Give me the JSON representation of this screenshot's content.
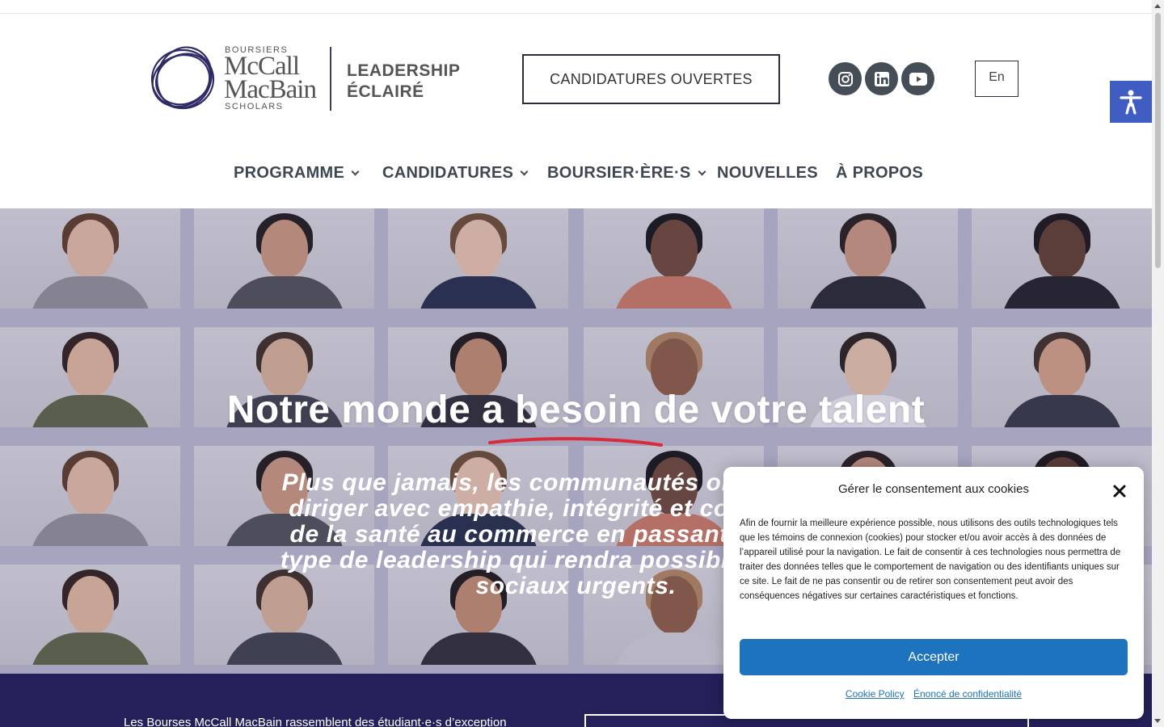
{
  "header": {
    "logo": {
      "top_small": "BOURSIERS",
      "name_line1": "McCall",
      "name_line2": "MacBain",
      "bottom_small": "SCHOLARS",
      "tagline_line1": "LEADERSHIP",
      "tagline_line2": "ÉCLAIRÉ"
    },
    "cta_label": "CANDIDATURES OUVERTES",
    "social": [
      "instagram-icon",
      "linkedin-icon",
      "youtube-icon"
    ],
    "language_label": "En",
    "accessibility_icon": "accessibility-icon"
  },
  "nav": {
    "items": [
      {
        "label": "PROGRAMME",
        "has_dropdown": true
      },
      {
        "label": "CANDIDATURES",
        "has_dropdown": true
      },
      {
        "label": "BOURSIER·ÈRE·S",
        "has_dropdown": true
      },
      {
        "label": "NOUVELLES",
        "has_dropdown": false
      },
      {
        "label": "À PROPOS",
        "has_dropdown": false
      }
    ]
  },
  "hero": {
    "title": "Notre monde a besoin de votre talent",
    "body_lines": [
      "Plus que jamais, les communautés ont besoin de",
      "diriger avec empathie, intégrité et courage dans",
      "de la santé au commerce en passant par la tech",
      "type de leadership qui rendra possible la mise en",
      "sociaux urgents."
    ],
    "accent_color": "#d92b3a"
  },
  "band": {
    "text": "Les Bourses McCall MacBain rassemblent des étudiant·e·s d’exception"
  },
  "cookie": {
    "title": "Gérer le consentement aux cookies",
    "body": "Afin de fournir la meilleure expérience possible, nous utilisons des outils technologiques tels que les témoins de connexion (cookies) pour stocker et/ou avoir accès à des données de l’appareil utilisé pour la navigation. Le fait de consentir à ces technologies nous permettra de traiter des données telles que le comportement de navigation ou des identifiants uniques sur ce site. Le fait de ne pas consentir ou de retirer son consentement peut avoir des conséquences négatives sur certaines caractéristiques et fonctions.",
    "accept_label": "Accepter",
    "link_policy": "Cookie Policy",
    "link_privacy": "Énoncé de confidentialité",
    "accent_color": "#1e73be"
  },
  "colors": {
    "brand_navy": "#24205a",
    "nav_text": "#3f4752",
    "accessibility_blue": "#3e5cc2"
  }
}
